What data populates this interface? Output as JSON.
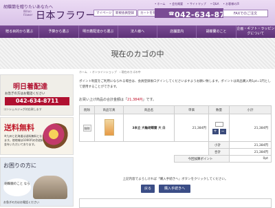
{
  "header": {
    "tagline": "胡蝶蘭を贈りたいあなたへ",
    "logo_en": "Nihon Flower",
    "logo": "日本フラワー",
    "top_links": [
      "ホーム",
      "会社概要",
      "サイトマップ",
      "Q&A",
      "お客様の声"
    ],
    "buttons": [
      "マイページ",
      "新規会員登録",
      "カートを見る"
    ],
    "phone": "042-634-8711",
    "fax_button": "FAXでのご注文"
  },
  "nav": {
    "items": [
      "贈る目的から選ぶ",
      "予算から選ぶ",
      "明日着配達から選ぶ",
      "法人様へ",
      "店舗案内",
      "胡蝶蘭のこと",
      "企画・ギフト・ラッピングについて"
    ]
  },
  "page": {
    "title": "現在のカゴの中",
    "breadcrumb": [
      "ホーム",
      "オンラインショップ",
      "現在のカゴの中"
    ]
  },
  "sidebar": {
    "banner1": {
      "head": "明日着配達",
      "sub": "お急ぎの方はお電話ください",
      "phone": "042-634-8711",
      "foot": "コンシェルジュが対応致します"
    },
    "banner2": {
      "head": "送料無料",
      "text": "※九州と北海道は送料無料となります。他地域は1000円の別途料金をいただいております。"
    },
    "banner3": {
      "head": "お困りの方に",
      "bubble": "胡蝶蘭のこと なら",
      "foot": "お急ぎの方はお電話ください"
    }
  },
  "cart": {
    "notice": "ポイント制度をご利用になられる場合は、会員登録後ログインしてくださいますようお願い致します。ポイントは商品購入時1pt=1円として使用することができます。",
    "total_prefix": "お買い上げ商品の合計金額は「",
    "total_amount": "21,384円",
    "total_suffix": "」です。",
    "headers": [
      "削除",
      "商品写真",
      "商品名",
      "単価",
      "数量",
      "小計"
    ],
    "item": {
      "delete": "削除",
      "name": "3本立 大輪胡蝶蘭 大 白",
      "price": "21,384円",
      "subtotal": "21,384円"
    },
    "summary": [
      {
        "label": "小計",
        "value": "21,384円"
      },
      {
        "label": "合計",
        "value": "21,384円"
      },
      {
        "label": "今回加算ポイント",
        "value": "0pt"
      }
    ],
    "guide": "上記内容でよろしければ「購入手続きへ」ボタンをクリックしてください。",
    "back_button": "戻る",
    "next_button": "購入手続きへ"
  }
}
